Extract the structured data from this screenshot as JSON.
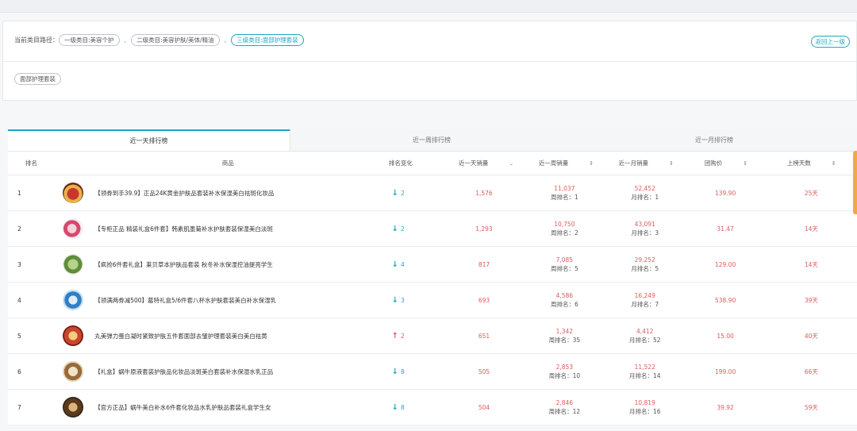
{
  "path": {
    "label": "当前类目路径：",
    "crumbs": [
      "一级类目:美容个护",
      "二级类目:美容护肤/美体/精油",
      "三级类目:面部护理套装"
    ],
    "back_label": "返回上一级"
  },
  "subcategory": "面部护理套装",
  "tabs": [
    "近一天排行榜",
    "近一周排行榜",
    "近一月排行榜"
  ],
  "columns": {
    "rank": "排名",
    "product": "商品",
    "change": "排名变化",
    "day_sales": "近一天销量",
    "week_sales": "近一周销量",
    "month_sales": "近一月销量",
    "price": "团购价",
    "days": "上榜天数"
  },
  "rows": [
    {
      "rank": "1",
      "title": "【领券到手39.9】正品24K黄金护肤品套装补水保湿美白祛斑化妆品",
      "dir": "down",
      "change": "2",
      "day": "1,576",
      "week": "11,037",
      "week_rank": "周排名：1",
      "month": "52,452",
      "month_rank": "月排名：1",
      "price": "139.90",
      "days": "25天"
    },
    {
      "rank": "2",
      "title": "【专柜正品 精装礼盒6件套】韩素肌墨菊补水护肤套装保湿美白淡斑",
      "dir": "down",
      "change": "2",
      "day": "1,293",
      "week": "10,750",
      "week_rank": "周排名：2",
      "month": "43,091",
      "month_rank": "月排名：3",
      "price": "31.47",
      "days": "14天"
    },
    {
      "rank": "3",
      "title": "【疯抢6件套礼盒】莱贝草本护肤品套装 秋冬补水保湿控油提亮学生",
      "dir": "down",
      "change": "4",
      "day": "817",
      "week": "7,085",
      "week_rank": "周排名：5",
      "month": "29,252",
      "month_rank": "月排名：5",
      "price": "129.00",
      "days": "14天"
    },
    {
      "rank": "4",
      "title": "【领满两券减500】葛特礼盒5/6件套八杯水护肤套装美白补水保湿乳",
      "dir": "down",
      "change": "3",
      "day": "693",
      "week": "4,586",
      "week_rank": "周排名：6",
      "month": "16,249",
      "month_rank": "月排名：7",
      "price": "538.90",
      "days": "39天"
    },
    {
      "rank": "5",
      "title": "丸美弹力蛋白凝时紧致护肤五件套面部去皱护理套装美白美白祛黄",
      "dir": "up",
      "change": "2",
      "day": "651",
      "week": "1,342",
      "week_rank": "周排名：35",
      "month": "4,412",
      "month_rank": "月排名：52",
      "price": "15.00",
      "days": "40天"
    },
    {
      "rank": "6",
      "title": "【礼盒】蜗牛原液套装护肤品化妆品淡斑美白套装补水保湿水乳正品",
      "dir": "down",
      "change": "8",
      "day": "505",
      "week": "2,853",
      "week_rank": "周排名：10",
      "month": "11,522",
      "month_rank": "月排名：14",
      "price": "199.00",
      "days": "66天"
    },
    {
      "rank": "7",
      "title": "【官方正品】蜗牛美白补水6件套化妆品水乳护肤品套装礼盒学生女",
      "dir": "down",
      "change": "8",
      "day": "504",
      "week": "2,846",
      "week_rank": "周排名：12",
      "month": "10,819",
      "month_rank": "月排名：16",
      "price": "39.92",
      "days": "59天"
    }
  ]
}
